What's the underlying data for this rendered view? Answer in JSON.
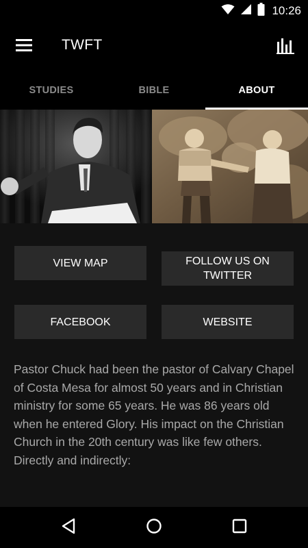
{
  "status_bar": {
    "time": "10:26",
    "icons": [
      "wifi-icon",
      "signal-icon",
      "battery-icon"
    ]
  },
  "app_bar": {
    "title": "TWFT",
    "left_icon": "menu-icon",
    "right_icon": "bar-chart-icon"
  },
  "tabs": [
    {
      "label": "STUDIES",
      "active": false
    },
    {
      "label": "BIBLE",
      "active": false
    },
    {
      "label": "ABOUT",
      "active": true
    }
  ],
  "buttons": {
    "view_map": "VIEW MAP",
    "follow_twitter": "FOLLOW US ON TWITTER",
    "facebook": "FACEBOOK",
    "website": "WEBSITE"
  },
  "about": {
    "description": "Pastor Chuck had been the pastor of Calvary Chapel of Costa Mesa for almost 50 years and in Christian ministry for some 65 years. He was 86 years old when he entered Glory. His impact on the Christian Church in the 20th century was like few others. Directly and indirectly:"
  },
  "nav_bar": {
    "icons": [
      "back-icon",
      "home-icon",
      "recents-icon"
    ]
  },
  "colors": {
    "background": "#121212",
    "bar": "#000000",
    "button": "#2a2a2a",
    "body_text": "#a9a9a9",
    "tab_inactive": "#8a8a8a",
    "tab_active": "#ffffff"
  }
}
